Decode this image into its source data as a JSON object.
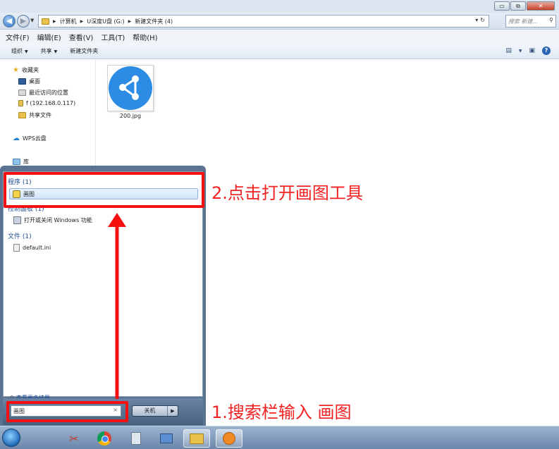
{
  "window": {
    "controls": [
      "▭",
      "⧉",
      "✕"
    ]
  },
  "address": {
    "crumbs": [
      "计算机",
      "U深度U盘 (G:)",
      "新建文件夹 (4)"
    ],
    "search_placeholder": "搜索 新建..."
  },
  "menubar": [
    "文件(F)",
    "编辑(E)",
    "查看(V)",
    "工具(T)",
    "帮助(H)"
  ],
  "toolbar": {
    "organize": "组织",
    "share": "共享",
    "new_folder": "新建文件夹"
  },
  "navpane": {
    "favorites": "收藏夹",
    "desktop": "桌面",
    "recent": "最近访问的位置",
    "network_share": "f (192.168.0.117)",
    "shared_files": "共享文件",
    "wps_cloud": "WPS云盘",
    "library": "库"
  },
  "files": [
    {
      "name": "200.jpg",
      "icon": "share-logo-image"
    }
  ],
  "startmenu": {
    "group_programs": "程序 (1)",
    "program_item": "画图",
    "group_control_panel": "控制面板 (1)",
    "control_item": "打开或关闭 Windows 功能",
    "group_files": "文件 (1)",
    "file_item": "default.ini",
    "more_results": "查看更多结果",
    "search_value": "画图",
    "shutdown": "关机"
  },
  "annotations": {
    "step2": "2.点击打开画图工具",
    "step1": "1.搜索栏输入 画图"
  },
  "colors": {
    "annotation_red": "#f12121",
    "accent_blue": "#2c8be3"
  }
}
